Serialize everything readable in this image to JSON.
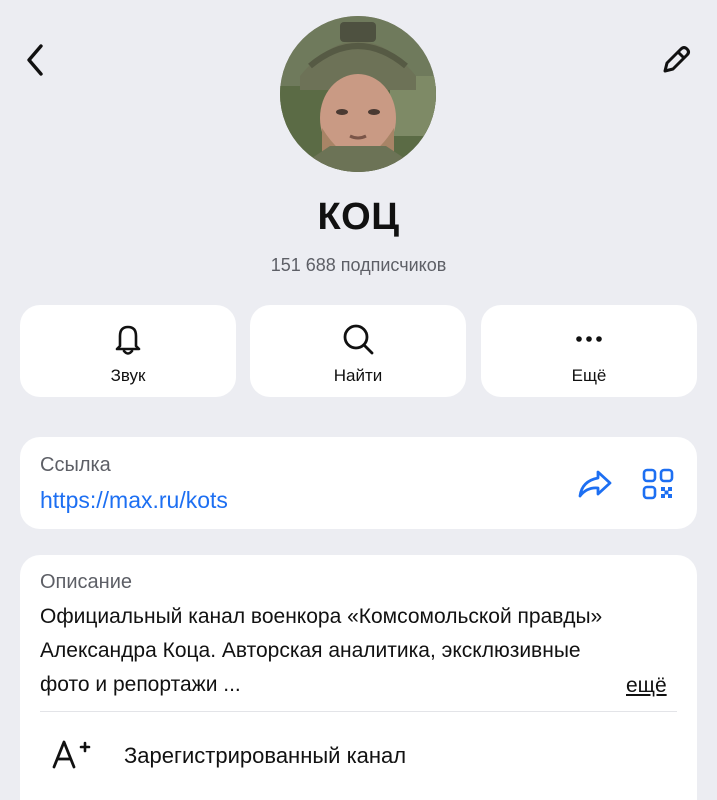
{
  "header": {
    "back_icon": "chevron-left-icon",
    "edit_icon": "pencil-icon"
  },
  "channel": {
    "title": "КОЦ",
    "subscribers": "151 688 подписчиков"
  },
  "actions": [
    {
      "label": "Звук",
      "icon": "bell-icon"
    },
    {
      "label": "Найти",
      "icon": "search-icon"
    },
    {
      "label": "Ещё",
      "icon": "more-dots-icon"
    }
  ],
  "link": {
    "caption": "Ссылка",
    "url": "https://max.ru/kots",
    "share_icon": "share-arrow-icon",
    "qr_icon": "qr-code-icon"
  },
  "description": {
    "caption": "Описание",
    "text": "Официальный канал военкора «Комсомольской правды» Александра Коца. Авторская аналитика, эксклюзивные фото и репортажи ...",
    "more_label": "ещё"
  },
  "verified": {
    "label": "Зарегистрированный канал",
    "icon": "registered-channel-icon"
  },
  "colors": {
    "background": "#ECEDF2",
    "card": "#FFFFFF",
    "accent": "#1D6FF2",
    "secondary_text": "#5D5F66"
  }
}
